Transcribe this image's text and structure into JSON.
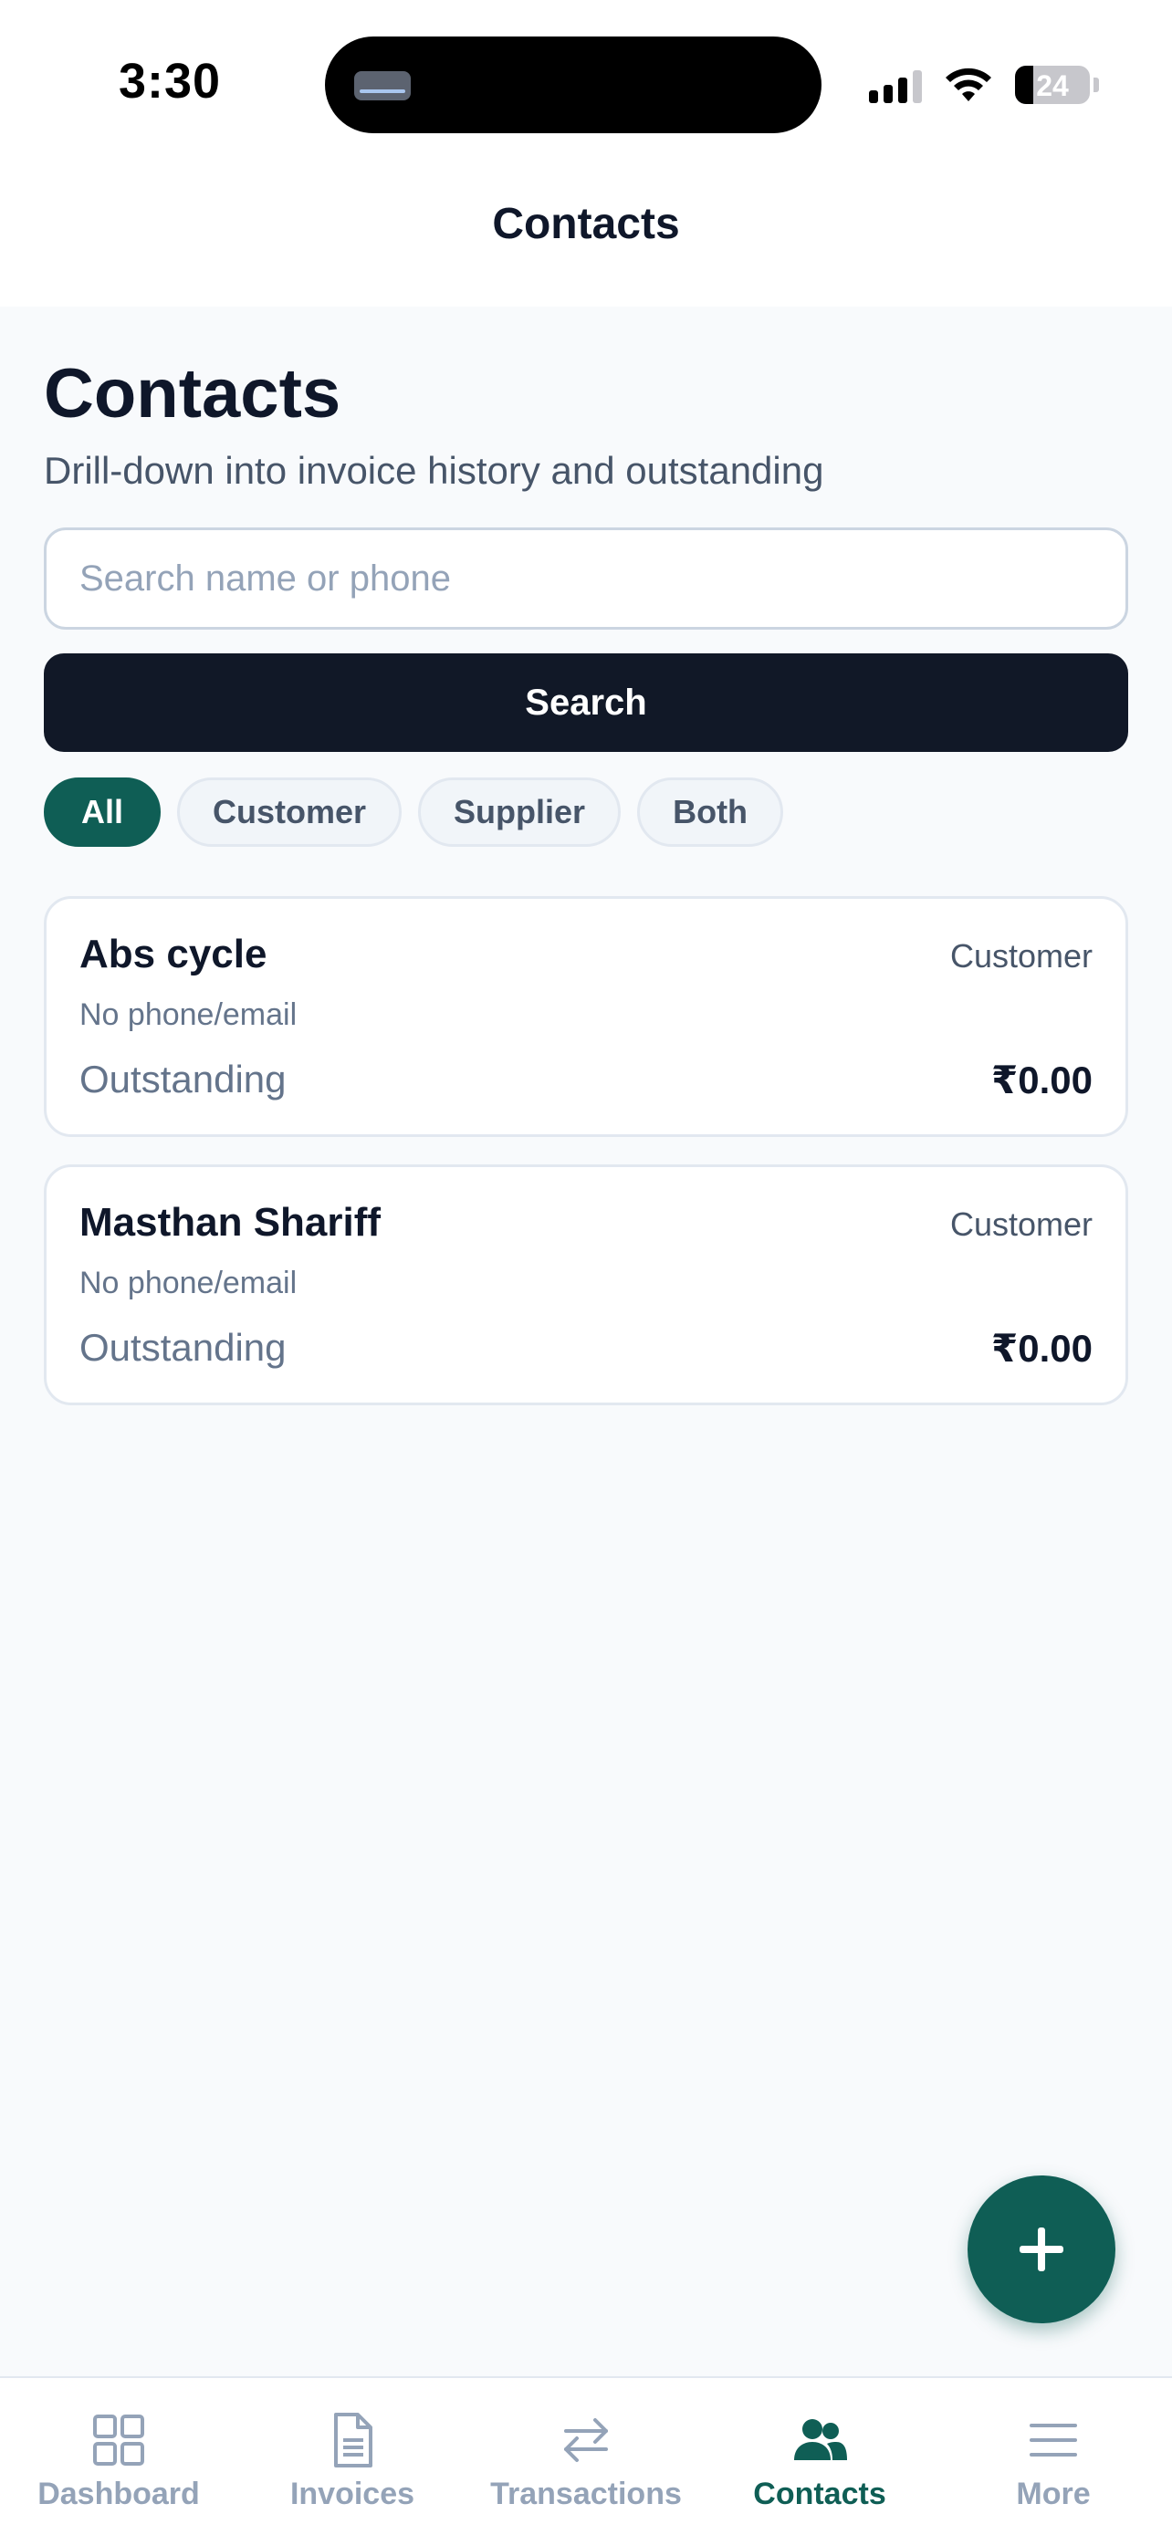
{
  "status_bar": {
    "time": "3:30",
    "battery": "24",
    "battery_level": 0.24
  },
  "header": {
    "title": "Contacts"
  },
  "page": {
    "title": "Contacts",
    "subtitle": "Drill-down into invoice history and outstanding"
  },
  "search": {
    "placeholder": "Search name or phone",
    "value": "",
    "button_label": "Search"
  },
  "filters": {
    "selected": "All",
    "items": [
      {
        "label": "All"
      },
      {
        "label": "Customer"
      },
      {
        "label": "Supplier"
      },
      {
        "label": "Both"
      }
    ]
  },
  "contacts": [
    {
      "name": "Abs cycle",
      "type": "Customer",
      "contact": "No phone/email",
      "outstanding_label": "Outstanding",
      "outstanding": "₹0.00"
    },
    {
      "name": "Masthan Shariff",
      "type": "Customer",
      "contact": "No phone/email",
      "outstanding_label": "Outstanding",
      "outstanding": "₹0.00"
    }
  ],
  "fab": {
    "icon": "plus-icon"
  },
  "tabbar": {
    "active": "Contacts",
    "items": [
      {
        "label": "Dashboard",
        "icon": "grid-icon"
      },
      {
        "label": "Invoices",
        "icon": "document-icon"
      },
      {
        "label": "Transactions",
        "icon": "arrows-swap-icon"
      },
      {
        "label": "Contacts",
        "icon": "people-icon"
      },
      {
        "label": "More",
        "icon": "menu-icon"
      }
    ]
  },
  "colors": {
    "accent": "#0f5e55",
    "button_dark": "#111827",
    "background": "#f8fafc",
    "muted_text": "#64748b",
    "inactive_tab": "#94a3b8"
  }
}
